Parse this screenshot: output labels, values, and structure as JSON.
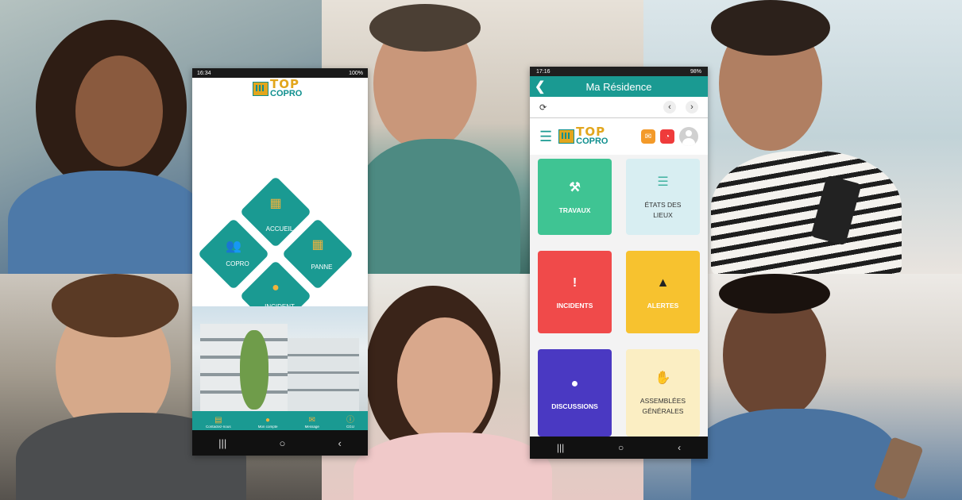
{
  "phone_left": {
    "status_bar": {
      "time": "16:34",
      "battery": "100%"
    },
    "logo": {
      "top": "TOP",
      "copro": "COPRO"
    },
    "menu": {
      "accueil": "ACCUEIL",
      "copro": "COPRO",
      "panne": "PANNE",
      "incident": "INCIDENT"
    },
    "bottom_nav": [
      {
        "label": "Contactez-nous",
        "icon": "document-icon"
      },
      {
        "label": "Mon compte",
        "icon": "user-icon"
      },
      {
        "label": "Message",
        "icon": "envelope-icon"
      },
      {
        "label": "CGU",
        "icon": "info-icon"
      }
    ]
  },
  "phone_right": {
    "status_bar": {
      "time": "17:16",
      "battery": "98%"
    },
    "title": "Ma Résidence",
    "logo": {
      "top": "TOP",
      "copro": "COPRO"
    },
    "cards": [
      {
        "label": "TRAVAUX",
        "icon": "hammer-icon",
        "color": "#3fc493"
      },
      {
        "label": "ÉTATS DES LIEUX",
        "icon": "checklist-icon",
        "color": "#d8eef2"
      },
      {
        "label": "INCIDENTS",
        "icon": "exclamation-icon",
        "color": "#f04a4a"
      },
      {
        "label": "ALERTES",
        "icon": "warning-icon",
        "color": "#f7c22f"
      },
      {
        "label": "DISCUSSIONS",
        "icon": "chat-icon",
        "color": "#4a39c2"
      },
      {
        "label": "ASSEMBLÉES GÉNÉRALES",
        "icon": "handshake-icon",
        "color": "#fbeec3"
      }
    ]
  },
  "colors": {
    "teal": "#1a9a92",
    "gold": "#e2a61d"
  }
}
